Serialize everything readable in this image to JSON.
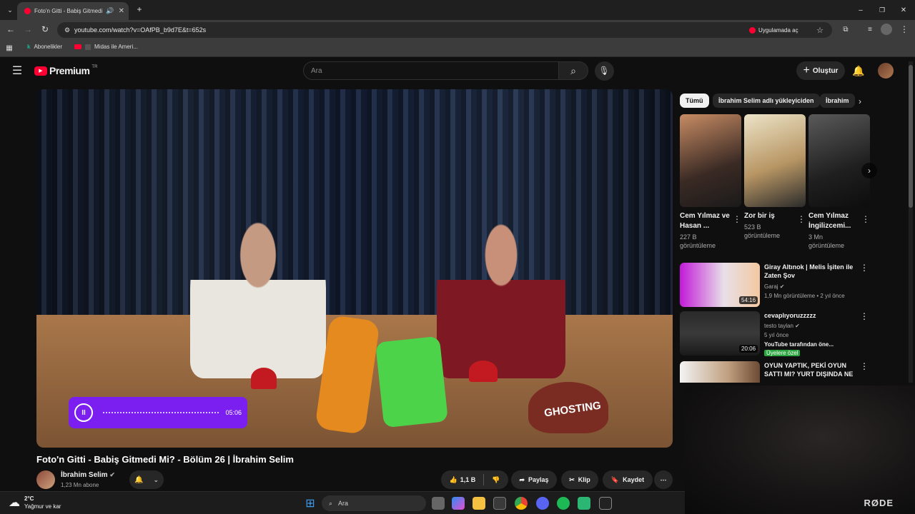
{
  "browser": {
    "tab_title": "Foto'n Gitti - Babiş Gitmedi",
    "url": "youtube.com/watch?v=OAfPB_b9d7E&t=652s",
    "open_in_app": "Uygulamada aç",
    "bookmarks": [
      "Abonelikler",
      "Midas ile Ameri..."
    ]
  },
  "youtube": {
    "logo": "Premium",
    "logo_region": "TR",
    "search_placeholder": "Ara",
    "create_label": "Oluştur"
  },
  "player": {
    "audio_time": "05:06",
    "overlay_brand": "GHOSTING"
  },
  "video": {
    "title": "Foto'n Gitti - Babiş Gitmedi Mi? - Bölüm 26 | İbrahim Selim",
    "channel": "İbrahim Selim",
    "subscribers": "1,23 Mn abone",
    "likes": "1,1 B",
    "share": "Paylaş",
    "clip": "Klip",
    "save": "Kaydet"
  },
  "chips": [
    "Tümü",
    "İbrahim Selim adlı yükleyiciden",
    "İbrahim"
  ],
  "shorts": [
    {
      "title": "Cem Yılmaz ve Hasan ...",
      "views": "227 B görüntüleme"
    },
    {
      "title": "Zor bir iş",
      "views": "523 B görüntüleme"
    },
    {
      "title": "Cem Yılmaz İngilizcemi...",
      "views": "3 Mn görüntüleme"
    }
  ],
  "recommendations": [
    {
      "title": "Giray Altınok | Melis İşiten ile Zaten Şov",
      "channel": "Garaj",
      "meta": "1,9 Mn görüntüleme • 2 yıl önce",
      "duration": "54:16"
    },
    {
      "title": "cevaplıyoruzzzzz",
      "channel": "testo taylan",
      "meta": "5 yıl önce",
      "extra": "YouTube tarafından öne...",
      "badge": "Üyelere özel",
      "duration": "20:06"
    },
    {
      "title": "OYUN YAPTIK, PEKİ OYUN SATTI MI? YURT DIŞINDA NE ...",
      "channel": "",
      "meta": "",
      "duration": ""
    }
  ],
  "weather": {
    "temp": "2°C",
    "desc": "Yağmur ve kar"
  },
  "taskbar": {
    "search": "Ara"
  },
  "camera_brand": "RØDE",
  "colors": {
    "accent": "#ff0033",
    "audio_widget": "#7b1ff0",
    "member_badge": "#2ba640"
  }
}
